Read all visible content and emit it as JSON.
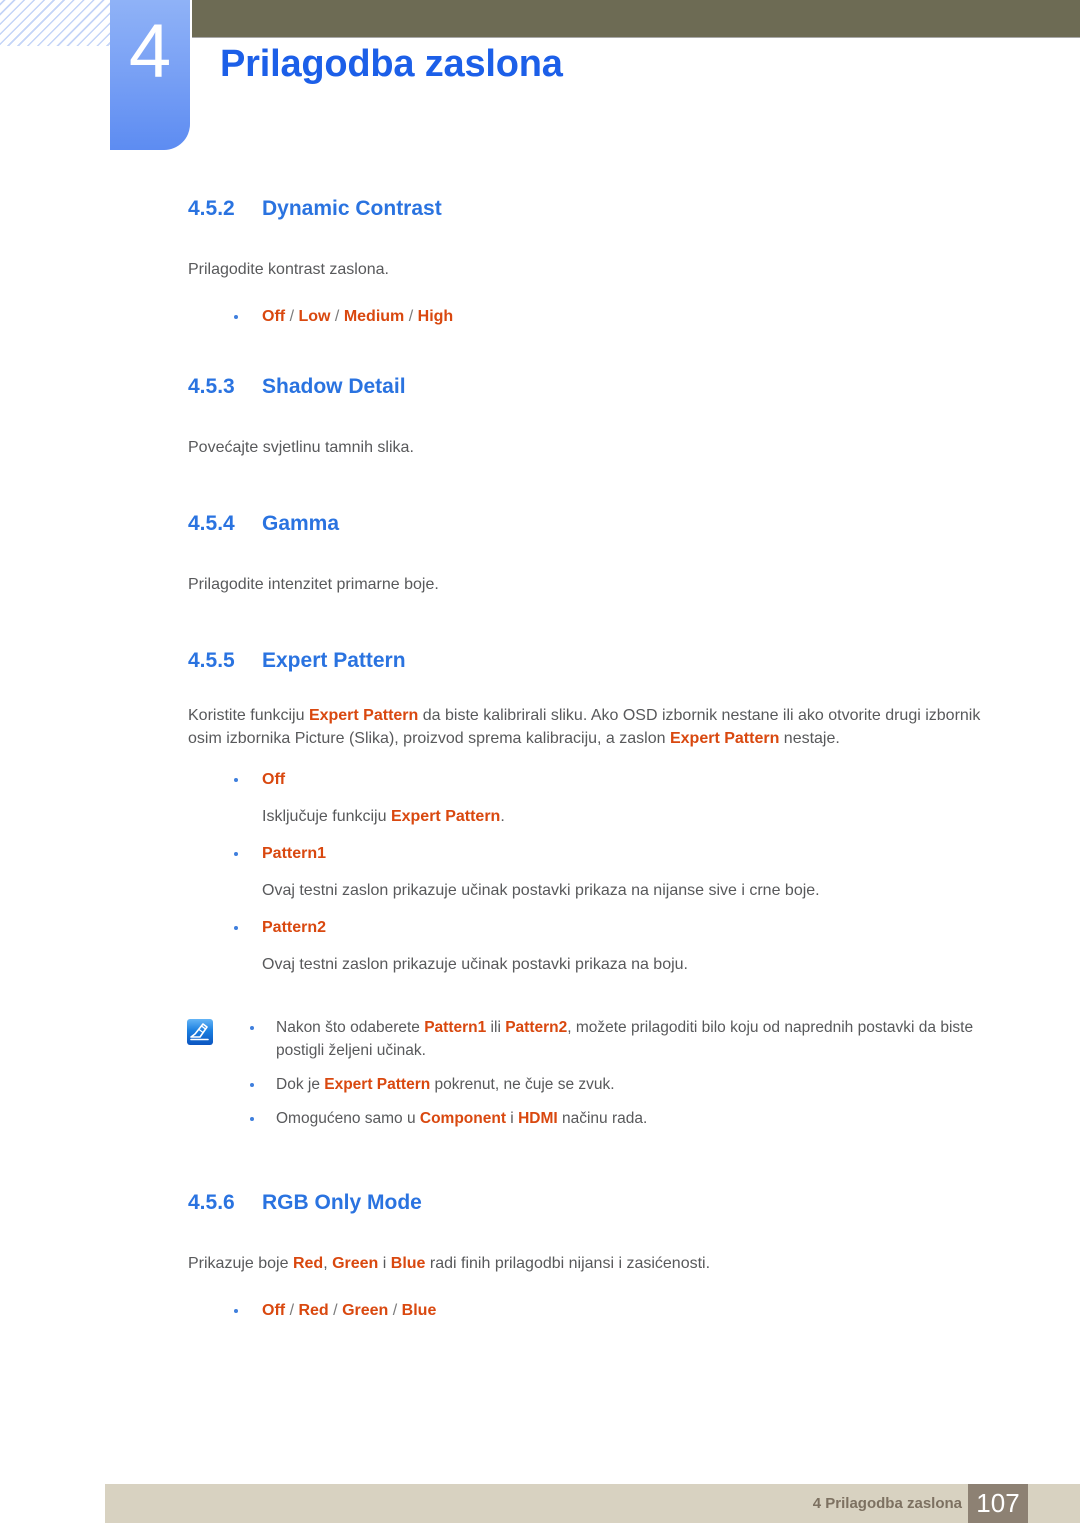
{
  "header": {
    "chapter_number": "4",
    "chapter_title": "Prilagodba zaslona",
    "accent_blue": "#1c5fe8",
    "tab_blue": "#7ca3f5",
    "bar_olive": "#6d6b54"
  },
  "sections": [
    {
      "number": "4.5.2",
      "title": "Dynamic Contrast",
      "body": "Prilagodite kontrast zaslona.",
      "options": [
        "Off",
        "Low",
        "Medium",
        "High"
      ]
    },
    {
      "number": "4.5.3",
      "title": "Shadow Detail",
      "body": "Povećajte svjetlinu tamnih slika."
    },
    {
      "number": "4.5.4",
      "title": "Gamma",
      "body": "Prilagodite intenzitet primarne boje."
    },
    {
      "number": "4.5.5",
      "title": "Expert Pattern",
      "intro": {
        "p1": "Koristite funkciju ",
        "hl1": "Expert Pattern",
        "p2": " da biste kalibrirali sliku. Ako OSD izbornik nestane ili ako otvorite drugi izbornik osim izbornika Picture (Slika), proizvod sprema kalibraciju, a zaslon ",
        "hl2": "Expert Pattern",
        "p3": " nestaje."
      },
      "items": [
        {
          "label": "Off",
          "desc_pre": "Isključuje funkciju ",
          "desc_hl": "Expert Pattern",
          "desc_post": "."
        },
        {
          "label": "Pattern1",
          "desc_pre": "Ovaj testni zaslon prikazuje učinak postavki prikaza na nijanse sive i crne boje.",
          "desc_hl": "",
          "desc_post": ""
        },
        {
          "label": "Pattern2",
          "desc_pre": "Ovaj testni zaslon prikazuje učinak postavki prikaza na boju.",
          "desc_hl": "",
          "desc_post": ""
        }
      ],
      "note": {
        "icon": "note-pen-icon",
        "lines": [
          {
            "a": "Nakon što odaberete ",
            "hl1": "Pattern1",
            "b": " ili ",
            "hl2": "Pattern2",
            "c": ", možete prilagoditi bilo koju od naprednih postavki da biste postigli željeni učinak."
          },
          {
            "a": "Dok je ",
            "hl1": "Expert Pattern",
            "b": " pokrenut, ne čuje se zvuk.",
            "hl2": "",
            "c": ""
          },
          {
            "a": "Omogućeno samo u ",
            "hl1": "Component",
            "b": " i ",
            "hl2": "HDMI",
            "c": " načinu rada."
          }
        ]
      }
    },
    {
      "number": "4.5.6",
      "title": "RGB Only Mode",
      "intro": {
        "p1": "Prikazuje boje ",
        "hl1": "Red",
        "p2": ", ",
        "hl2": "Green",
        "p3": " i ",
        "hl3": "Blue",
        "p4": " radi finih prilagodbi nijansi i zasićenosti."
      },
      "options": [
        "Off",
        "Red",
        "Green",
        "Blue"
      ]
    }
  ],
  "footer": {
    "text": "4 Prilagodba zaslona",
    "page": "107",
    "bar_color": "#d8d2c1",
    "page_box_color": "#8d8173"
  },
  "separator": "/"
}
